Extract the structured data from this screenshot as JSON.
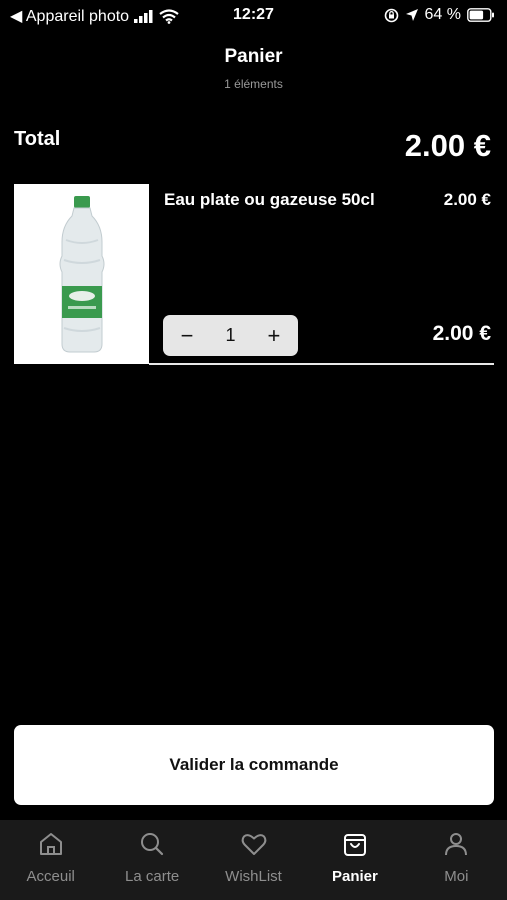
{
  "status_bar": {
    "back_app": "◀ Appareil photo",
    "time": "12:27",
    "battery_percent": "64 %"
  },
  "header": {
    "title": "Panier",
    "subtitle": "1 éléments"
  },
  "summary": {
    "total_label": "Total",
    "total_value": "2.00 €"
  },
  "cart_items": [
    {
      "name": "Eau plate ou gazeuse 50cl",
      "unit_price": "2.00 €",
      "quantity": "1",
      "minus_label": "−",
      "plus_label": "+",
      "line_total": "2.00 €"
    }
  ],
  "checkout": {
    "label": "Valider la commande"
  },
  "tab_bar": {
    "tabs": [
      {
        "label": "Acceuil",
        "icon": "home-icon",
        "active": false
      },
      {
        "label": "La carte",
        "icon": "search-icon",
        "active": false
      },
      {
        "label": "WishList",
        "icon": "heart-icon",
        "active": false
      },
      {
        "label": "Panier",
        "icon": "shopping-bag-icon",
        "active": true
      },
      {
        "label": "Moi",
        "icon": "user-icon",
        "active": false
      }
    ]
  },
  "colors": {
    "background": "#000000",
    "tab_bar_background": "#1a1a1a",
    "tab_inactive": "#8e8e8e",
    "tab_active": "#ffffff",
    "bottle_label_green": "#3a9a4e"
  }
}
